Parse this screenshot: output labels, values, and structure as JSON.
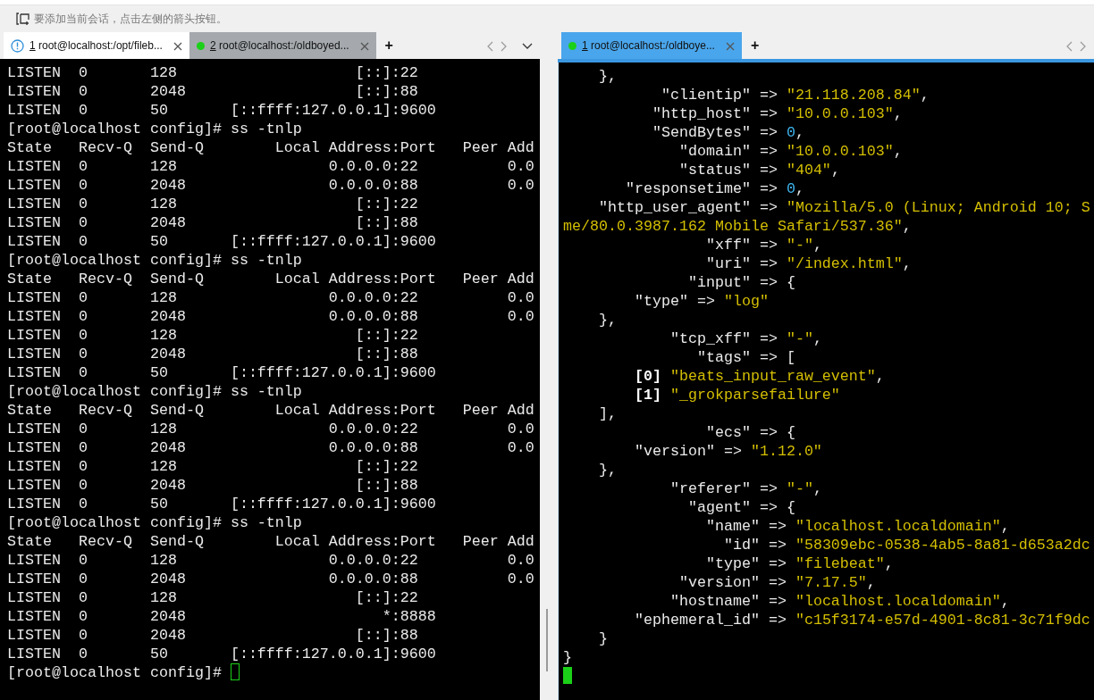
{
  "hint_bar": {
    "text": "要添加当前会话，点击左侧的箭头按钮。"
  },
  "panes": [
    {
      "active": false,
      "tabs": [
        {
          "number": "1",
          "title": "root@localhost:/opt/fileb...",
          "kind": "info",
          "selected": true
        },
        {
          "number": "2",
          "title": "root@localhost:/oldboyed...",
          "kind": "connected",
          "selected": false
        }
      ],
      "add_label": "+",
      "menu": true,
      "scrollbar": true,
      "cursor_filled": false,
      "lines": [
        [
          {
            "text": "LISTEN  0       128                    [::]:22",
            "kind": "plain"
          }
        ],
        [
          {
            "text": "LISTEN  0       2048                   [::]:88",
            "kind": "plain"
          }
        ],
        [
          {
            "text": "LISTEN  0       50       [::ffff:127.0.0.1]:9600",
            "kind": "plain"
          }
        ],
        [
          {
            "text": "[root@localhost config]# ss -tnlp",
            "kind": "plain"
          }
        ],
        [
          {
            "text": "State   Recv-Q  Send-Q        Local Address:Port   Peer Add",
            "kind": "plain"
          }
        ],
        [
          {
            "text": "LISTEN  0       128                 0.0.0.0:22          0.0",
            "kind": "plain"
          }
        ],
        [
          {
            "text": "LISTEN  0       2048                0.0.0.0:88          0.0",
            "kind": "plain"
          }
        ],
        [
          {
            "text": "LISTEN  0       128                    [::]:22",
            "kind": "plain"
          }
        ],
        [
          {
            "text": "LISTEN  0       2048                   [::]:88",
            "kind": "plain"
          }
        ],
        [
          {
            "text": "LISTEN  0       50       [::ffff:127.0.0.1]:9600",
            "kind": "plain"
          }
        ],
        [
          {
            "text": "[root@localhost config]# ss -tnlp",
            "kind": "plain"
          }
        ],
        [
          {
            "text": "State   Recv-Q  Send-Q        Local Address:Port   Peer Add",
            "kind": "plain"
          }
        ],
        [
          {
            "text": "LISTEN  0       128                 0.0.0.0:22          0.0",
            "kind": "plain"
          }
        ],
        [
          {
            "text": "LISTEN  0       2048                0.0.0.0:88          0.0",
            "kind": "plain"
          }
        ],
        [
          {
            "text": "LISTEN  0       128                    [::]:22",
            "kind": "plain"
          }
        ],
        [
          {
            "text": "LISTEN  0       2048                   [::]:88",
            "kind": "plain"
          }
        ],
        [
          {
            "text": "LISTEN  0       50       [::ffff:127.0.0.1]:9600",
            "kind": "plain"
          }
        ],
        [
          {
            "text": "[root@localhost config]# ss -tnlp",
            "kind": "plain"
          }
        ],
        [
          {
            "text": "State   Recv-Q  Send-Q        Local Address:Port   Peer Add",
            "kind": "plain"
          }
        ],
        [
          {
            "text": "LISTEN  0       128                 0.0.0.0:22          0.0",
            "kind": "plain"
          }
        ],
        [
          {
            "text": "LISTEN  0       2048                0.0.0.0:88          0.0",
            "kind": "plain"
          }
        ],
        [
          {
            "text": "LISTEN  0       128                    [::]:22",
            "kind": "plain"
          }
        ],
        [
          {
            "text": "LISTEN  0       2048                   [::]:88",
            "kind": "plain"
          }
        ],
        [
          {
            "text": "LISTEN  0       50       [::ffff:127.0.0.1]:9600",
            "kind": "plain"
          }
        ],
        [
          {
            "text": "[root@localhost config]# ss -tnlp",
            "kind": "plain"
          }
        ],
        [
          {
            "text": "State   Recv-Q  Send-Q        Local Address:Port   Peer Add",
            "kind": "plain"
          }
        ],
        [
          {
            "text": "LISTEN  0       128                 0.0.0.0:22          0.0",
            "kind": "plain"
          }
        ],
        [
          {
            "text": "LISTEN  0       2048                0.0.0.0:88          0.0",
            "kind": "plain"
          }
        ],
        [
          {
            "text": "LISTEN  0       128                    [::]:22",
            "kind": "plain"
          }
        ],
        [
          {
            "text": "LISTEN  0       2048                      *:8888",
            "kind": "plain"
          }
        ],
        [
          {
            "text": "LISTEN  0       2048                   [::]:88",
            "kind": "plain"
          }
        ],
        [
          {
            "text": "LISTEN  0       50       [::ffff:127.0.0.1]:9600",
            "kind": "plain"
          }
        ],
        [
          {
            "text": "[root@localhost config]# ",
            "kind": "plain"
          }
        ]
      ]
    },
    {
      "active": true,
      "tabs": [
        {
          "number": "1",
          "title": "root@localhost:/oldboye...",
          "kind": "connected",
          "selected": true
        }
      ],
      "add_label": "+",
      "menu": false,
      "cursor_filled": true,
      "lines": [
        [
          {
            "text": "    },",
            "kind": "plain"
          }
        ],
        [
          {
            "text": "           \"clientip\" => ",
            "kind": "plain"
          },
          {
            "text": "\"21.118.208.84\"",
            "kind": "string"
          },
          {
            "text": ",",
            "kind": "plain"
          }
        ],
        [
          {
            "text": "          \"http_host\" => ",
            "kind": "plain"
          },
          {
            "text": "\"10.0.0.103\"",
            "kind": "string"
          },
          {
            "text": ",",
            "kind": "plain"
          }
        ],
        [
          {
            "text": "          \"SendBytes\" => ",
            "kind": "plain"
          },
          {
            "text": "0",
            "kind": "number"
          },
          {
            "text": ",",
            "kind": "plain"
          }
        ],
        [
          {
            "text": "             \"domain\" => ",
            "kind": "plain"
          },
          {
            "text": "\"10.0.0.103\"",
            "kind": "string"
          },
          {
            "text": ",",
            "kind": "plain"
          }
        ],
        [
          {
            "text": "             \"status\" => ",
            "kind": "plain"
          },
          {
            "text": "\"404\"",
            "kind": "string"
          },
          {
            "text": ",",
            "kind": "plain"
          }
        ],
        [
          {
            "text": "       \"responsetime\" => ",
            "kind": "plain"
          },
          {
            "text": "0",
            "kind": "number"
          },
          {
            "text": ",",
            "kind": "plain"
          }
        ],
        [
          {
            "text": "    \"http_user_agent\" => ",
            "kind": "plain"
          },
          {
            "text": "\"Mozilla/5.0 (Linux; Android 10; S",
            "kind": "string"
          }
        ],
        [
          {
            "text": "me/80.0.3987.162 Mobile Safari/537.36\"",
            "kind": "string"
          },
          {
            "text": ",",
            "kind": "plain"
          }
        ],
        [
          {
            "text": "                \"xff\" => ",
            "kind": "plain"
          },
          {
            "text": "\"-\"",
            "kind": "string"
          },
          {
            "text": ",",
            "kind": "plain"
          }
        ],
        [
          {
            "text": "                \"uri\" => ",
            "kind": "plain"
          },
          {
            "text": "\"/index.html\"",
            "kind": "string"
          },
          {
            "text": ",",
            "kind": "plain"
          }
        ],
        [
          {
            "text": "              \"input\" => {",
            "kind": "plain"
          }
        ],
        [
          {
            "text": "        \"type\" => ",
            "kind": "plain"
          },
          {
            "text": "\"log\"",
            "kind": "string"
          }
        ],
        [
          {
            "text": "    },",
            "kind": "plain"
          }
        ],
        [
          {
            "text": "            \"tcp_xff\" => ",
            "kind": "plain"
          },
          {
            "text": "\"-\"",
            "kind": "string"
          },
          {
            "text": ",",
            "kind": "plain"
          }
        ],
        [
          {
            "text": "               \"tags\" => [",
            "kind": "plain"
          }
        ],
        [
          {
            "text": "        [0]",
            "kind": "index"
          },
          {
            "text": " \"beats_input_raw_event\"",
            "kind": "string"
          },
          {
            "text": ",",
            "kind": "plain"
          }
        ],
        [
          {
            "text": "        [1]",
            "kind": "index"
          },
          {
            "text": " \"_grokparsefailure\"",
            "kind": "string"
          }
        ],
        [
          {
            "text": "    ],",
            "kind": "plain"
          }
        ],
        [
          {
            "text": "                \"ecs\" => {",
            "kind": "plain"
          }
        ],
        [
          {
            "text": "        \"version\" => ",
            "kind": "plain"
          },
          {
            "text": "\"1.12.0\"",
            "kind": "string"
          }
        ],
        [
          {
            "text": "    },",
            "kind": "plain"
          }
        ],
        [
          {
            "text": "            \"referer\" => ",
            "kind": "plain"
          },
          {
            "text": "\"-\"",
            "kind": "string"
          },
          {
            "text": ",",
            "kind": "plain"
          }
        ],
        [
          {
            "text": "              \"agent\" => {",
            "kind": "plain"
          }
        ],
        [
          {
            "text": "                \"name\" => ",
            "kind": "plain"
          },
          {
            "text": "\"localhost.localdomain\"",
            "kind": "string"
          },
          {
            "text": ",",
            "kind": "plain"
          }
        ],
        [
          {
            "text": "                  \"id\" => ",
            "kind": "plain"
          },
          {
            "text": "\"58309ebc-0538-4ab5-8a81-d653a2dc",
            "kind": "string"
          }
        ],
        [
          {
            "text": "                \"type\" => ",
            "kind": "plain"
          },
          {
            "text": "\"filebeat\"",
            "kind": "string"
          },
          {
            "text": ",",
            "kind": "plain"
          }
        ],
        [
          {
            "text": "             \"version\" => ",
            "kind": "plain"
          },
          {
            "text": "\"7.17.5\"",
            "kind": "string"
          },
          {
            "text": ",",
            "kind": "plain"
          }
        ],
        [
          {
            "text": "            \"hostname\" => ",
            "kind": "plain"
          },
          {
            "text": "\"localhost.localdomain\"",
            "kind": "string"
          },
          {
            "text": ",",
            "kind": "plain"
          }
        ],
        [
          {
            "text": "        \"ephemeral_id\" => ",
            "kind": "plain"
          },
          {
            "text": "\"c15f3174-e57d-4901-8c81-3c71f9dc",
            "kind": "string"
          }
        ],
        [
          {
            "text": "    }",
            "kind": "plain"
          }
        ],
        [
          {
            "text": "}",
            "kind": "plain"
          }
        ]
      ]
    }
  ]
}
